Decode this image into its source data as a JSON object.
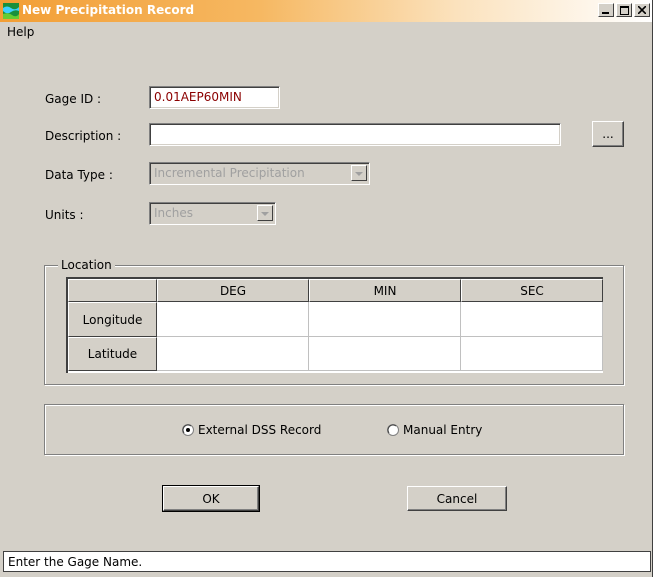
{
  "window": {
    "title": "New Precipitation Record",
    "icon": "map-icon"
  },
  "menu": {
    "help_label": "Help"
  },
  "form": {
    "gage_id_label": "Gage ID :",
    "gage_id_value": "0.01AEP60MIN",
    "gage_id_color": "#8b0000",
    "description_label": "Description :",
    "description_value": "",
    "browse_label": "...",
    "data_type_label": "Data Type :",
    "data_type_value": "Incremental Precipitation",
    "units_label": "Units :",
    "units_value": "Inches"
  },
  "location": {
    "group_label": "Location",
    "columns": [
      "DEG",
      "MIN",
      "SEC"
    ],
    "rows": [
      {
        "label": "Longitude",
        "values": [
          "",
          "",
          ""
        ]
      },
      {
        "label": "Latitude",
        "values": [
          "",
          "",
          ""
        ]
      }
    ]
  },
  "source": {
    "options": [
      {
        "label": "External DSS Record",
        "selected": true
      },
      {
        "label": "Manual Entry",
        "selected": false
      }
    ]
  },
  "buttons": {
    "ok_label": "OK",
    "cancel_label": "Cancel"
  },
  "status": {
    "text": "Enter the Gage Name."
  }
}
